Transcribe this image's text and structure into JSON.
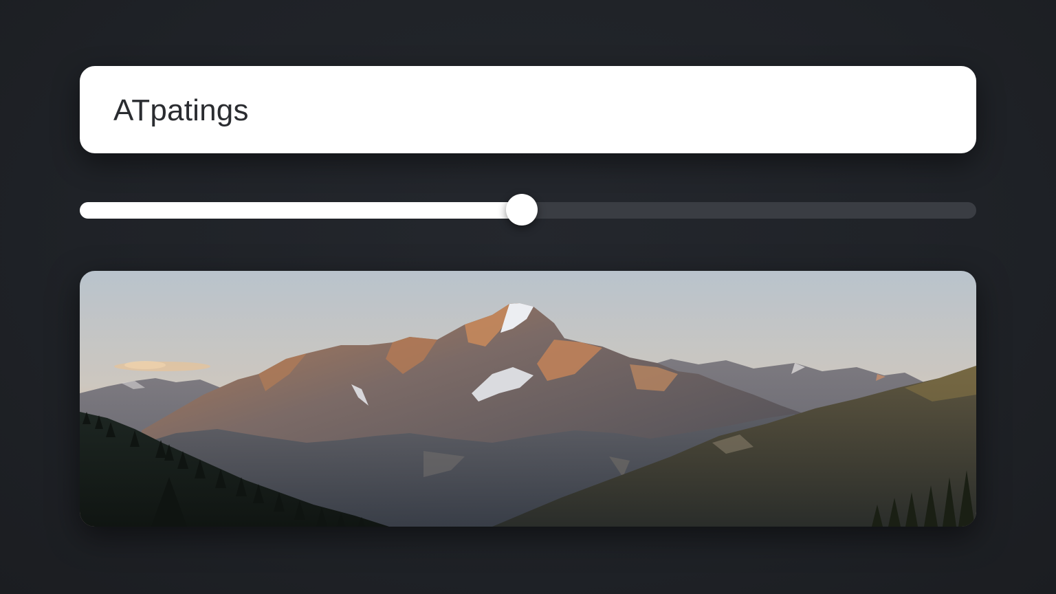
{
  "title_card": {
    "text": "ATpatings"
  },
  "slider": {
    "value_fraction": 0.493,
    "fill_color": "#ffffff",
    "track_color": "#3a3d43"
  },
  "image": {
    "subject": "mountain-landscape-photo"
  },
  "colors": {
    "background": "#1f2227",
    "card": "#ffffff",
    "text": "#2a2c30"
  }
}
